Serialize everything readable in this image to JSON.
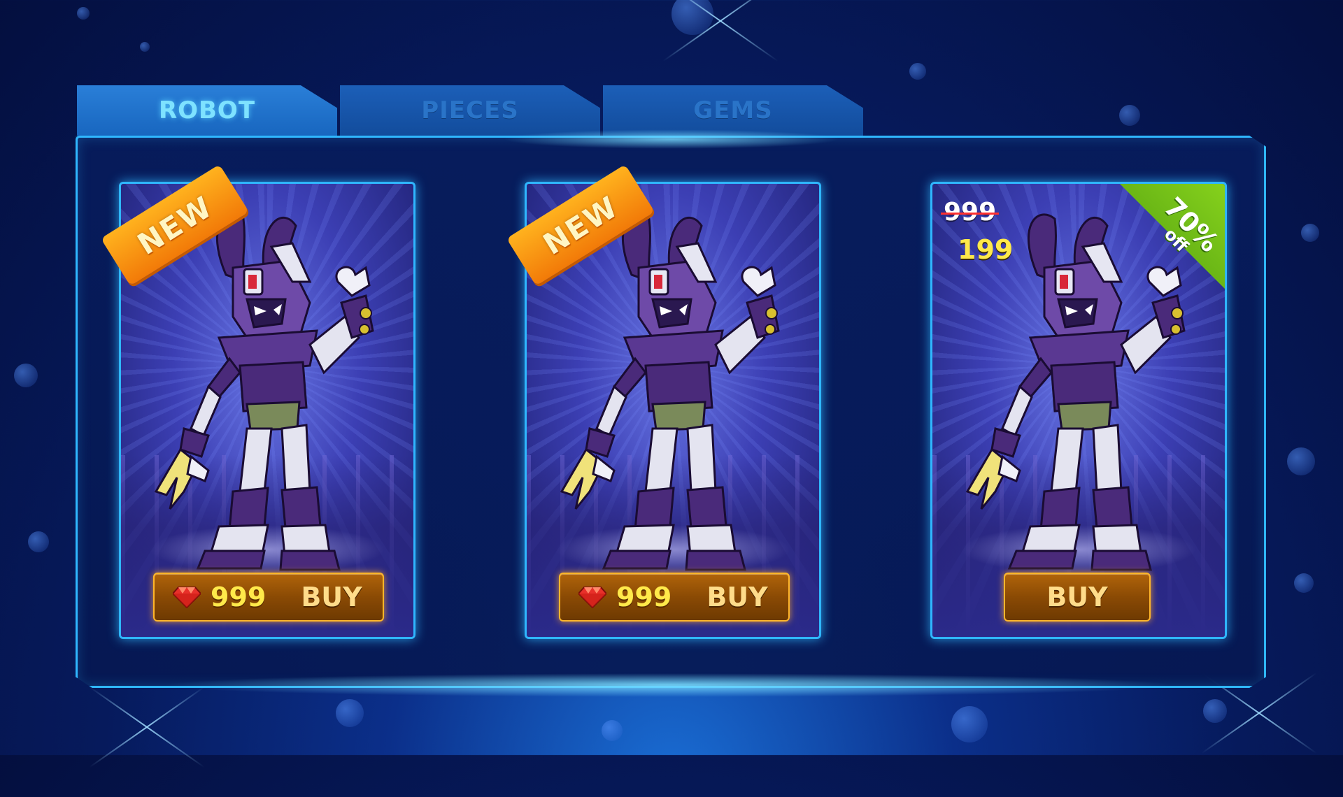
{
  "tabs": [
    {
      "label": "ROBOT",
      "active": true
    },
    {
      "label": "PIECES",
      "active": false
    },
    {
      "label": "GEMS",
      "active": false
    }
  ],
  "cards": [
    {
      "badge": "NEW",
      "price": "999",
      "buy_label": "BUY",
      "currency_icon": "gem-icon"
    },
    {
      "badge": "NEW",
      "price": "999",
      "buy_label": "BUY",
      "currency_icon": "gem-icon"
    },
    {
      "old_price": "999",
      "new_price": "199",
      "discount": "70%",
      "discount_suffix": "off",
      "buy_label": "BUY"
    }
  ],
  "colors": {
    "accent": "#2fb6ff",
    "button": "#8a4a04",
    "price": "#ffe94a",
    "ribbon": "#f27a08",
    "sale": "#6cb816",
    "robot_purple": "#4a2a7a"
  }
}
